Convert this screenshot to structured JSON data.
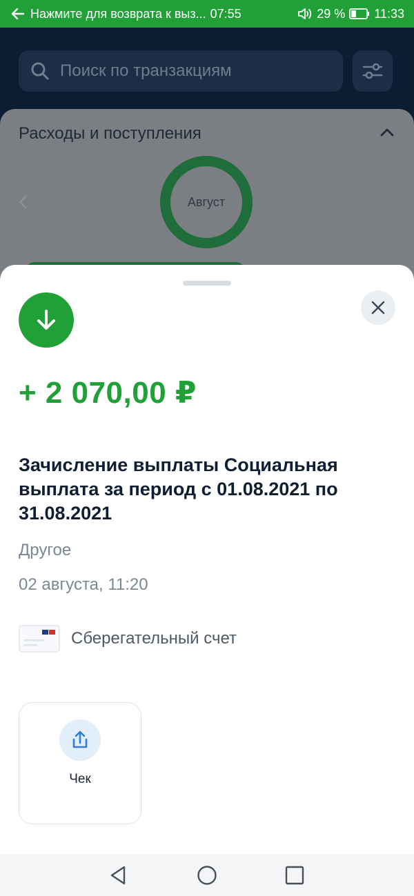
{
  "status_bar": {
    "return_text": "Нажмите для возврата к выз...",
    "call_timer": "07:55",
    "battery": "29 %",
    "time": "11:33",
    "bar_color": "#21a038"
  },
  "search": {
    "placeholder": "Поиск по транзакциям"
  },
  "summary_card": {
    "title": "Расходы и поступления",
    "month": "Август"
  },
  "transaction": {
    "type_icon": "arrow-down-icon",
    "amount": "+ 2 070,00 ₽",
    "description": "Зачисление выплаты Социальная выплата за период с 01.08.2021 по 31.08.2021",
    "category": "Другое",
    "datetime": "02 августа, 11:20",
    "account": "Сберегательный счет",
    "accent_color": "#21a038"
  },
  "actions": {
    "receipt_label": "Чек"
  },
  "icons": [
    "back-arrow-icon",
    "volume-icon",
    "battery-icon",
    "search-icon",
    "filter-icon",
    "chevron-up-icon",
    "chevron-left-icon",
    "close-icon",
    "share-icon",
    "nav-back-icon",
    "nav-home-icon",
    "nav-recents-icon"
  ]
}
